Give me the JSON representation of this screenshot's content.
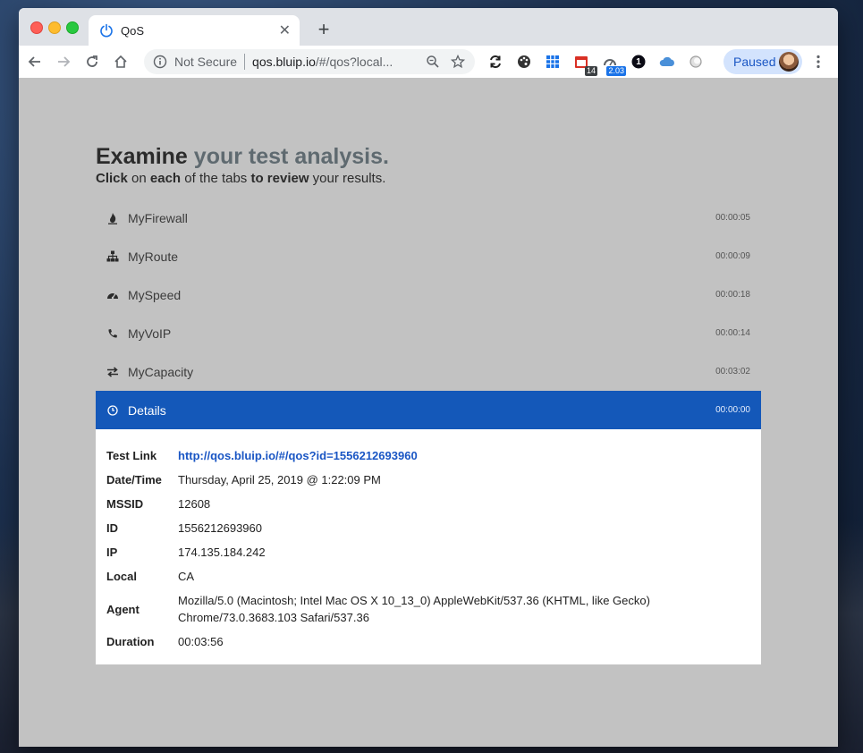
{
  "browser": {
    "tab": {
      "title": "QoS"
    },
    "omnibox": {
      "security_label": "Not Secure",
      "url_host": "qos.bluip.io",
      "url_rest": "/#/qos?local..."
    },
    "extensions": [
      {
        "icon": "sync-icon"
      },
      {
        "icon": "palette-icon"
      },
      {
        "icon": "grid-icon",
        "color": "#1a73e8"
      },
      {
        "icon": "calendar-icon",
        "badge": "14",
        "badge_color": "#3c4043"
      },
      {
        "icon": "speedometer-icon",
        "badge": "2.03",
        "badge_color": "#1a73e8"
      },
      {
        "icon": "onepassword-icon",
        "text": "1"
      },
      {
        "icon": "cloud-icon",
        "color": "#4a90d9"
      },
      {
        "icon": "circle-icon"
      }
    ],
    "profile": {
      "label": "Paused"
    }
  },
  "page": {
    "heading_strong": "Examine",
    "heading_muted": "your test analysis.",
    "sub_1": "Click",
    "sub_2": " on ",
    "sub_3": "each",
    "sub_4": " of the tabs ",
    "sub_5": "to review",
    "sub_6": " your results.",
    "tests": [
      {
        "label": "MyFirewall",
        "time": "00:00:05",
        "icon": "fire-icon"
      },
      {
        "label": "MyRoute",
        "time": "00:00:09",
        "icon": "sitemap-icon"
      },
      {
        "label": "MySpeed",
        "time": "00:00:18",
        "icon": "gauge-icon"
      },
      {
        "label": "MyVoIP",
        "time": "00:00:14",
        "icon": "phone-icon"
      },
      {
        "label": "MyCapacity",
        "time": "00:03:02",
        "icon": "exchange-icon"
      },
      {
        "label": "Details",
        "time": "00:00:00",
        "icon": "clock-icon",
        "active": true
      }
    ],
    "details": [
      {
        "key": "Test Link",
        "value": "http://qos.bluip.io/#/qos?id=1556212693960"
      },
      {
        "key": "Date/Time",
        "value": "Thursday, April 25, 2019 @ 1:22:09 PM"
      },
      {
        "key": "MSSID",
        "value": "12608"
      },
      {
        "key": "ID",
        "value": "1556212693960"
      },
      {
        "key": "IP",
        "value": "174.135.184.242"
      },
      {
        "key": "Local",
        "value": "CA"
      },
      {
        "key": "Agent",
        "value": "Mozilla/5.0 (Macintosh; Intel Mac OS X 10_13_0) AppleWebKit/537.36 (KHTML, like Gecko) Chrome/73.0.3683.103 Safari/537.36"
      },
      {
        "key": "Duration",
        "value": "00:03:56"
      }
    ]
  }
}
